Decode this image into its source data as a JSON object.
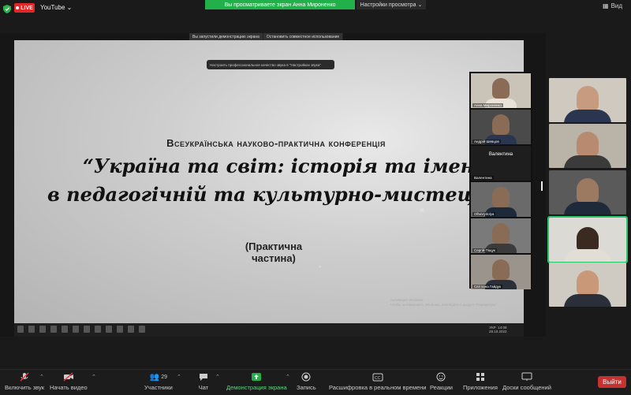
{
  "top_bar": {
    "live_label": "LIVE",
    "stream_target": "YouTube",
    "share_banner": "Вы просматриваете экран Анна Мироненко",
    "view_settings": "Настройки просмотра",
    "view_label": "Вид"
  },
  "shared_screen": {
    "mini_toolbar": [
      "Вы запустили демонстрацию экрана",
      "Остановить совместное использование"
    ],
    "sound_tip": "Настроить профессиональное качество звука в \"Настройках звука\"",
    "slide": {
      "subtitle": "Всеукраїнська науково-практична конференція",
      "title_line1": "“Україна та світ: історія та імена",
      "title_line2": "в педагогічній та культурно-мистецькій думці”",
      "part": "(Практична частина)"
    },
    "watermark": "Активация Windows\nЧтобы активировать Windows, перейдите в раздел \"Параметры\".",
    "tray": {
      "lang": "УКР",
      "time": "14:08",
      "date": "28.10.2022"
    },
    "inner_gallery": [
      {
        "name": "Анна Мироненко",
        "kind": "video"
      },
      {
        "name": "Андрій Шевцов",
        "kind": "video"
      },
      {
        "name": "Валентина",
        "kind": "name"
      },
      {
        "name": "OlhaVydolya",
        "kind": "video"
      },
      {
        "name": "Сергій Піщук",
        "kind": "video"
      },
      {
        "name": "Світлана Гайдук",
        "kind": "video"
      }
    ]
  },
  "right_gallery": [
    {
      "id": "p1",
      "active": false,
      "shirt": "#2a3550"
    },
    {
      "id": "p2",
      "active": false,
      "shirt": "#3b3b3b"
    },
    {
      "id": "p3",
      "active": false,
      "shirt": "#1e2a3a"
    },
    {
      "id": "p4",
      "active": true,
      "shirt": "#d8d4cc"
    },
    {
      "id": "p5",
      "active": false,
      "shirt": "#2b2f3a"
    }
  ],
  "toolbar": {
    "unmute": "Включить звук",
    "start_video": "Начать видео",
    "participants": "Участники",
    "participants_count": "29",
    "chat": "Чат",
    "share_screen": "Демонстрация экрана",
    "record": "Запись",
    "captions": "Расшифровка в реальном времени",
    "reactions": "Реакции",
    "apps": "Приложения",
    "whiteboards": "Доски сообщений",
    "leave": "Выйти"
  },
  "colors": {
    "accent_green": "#22b04a",
    "live_red": "#e02828",
    "leave_red": "#c5322f"
  }
}
